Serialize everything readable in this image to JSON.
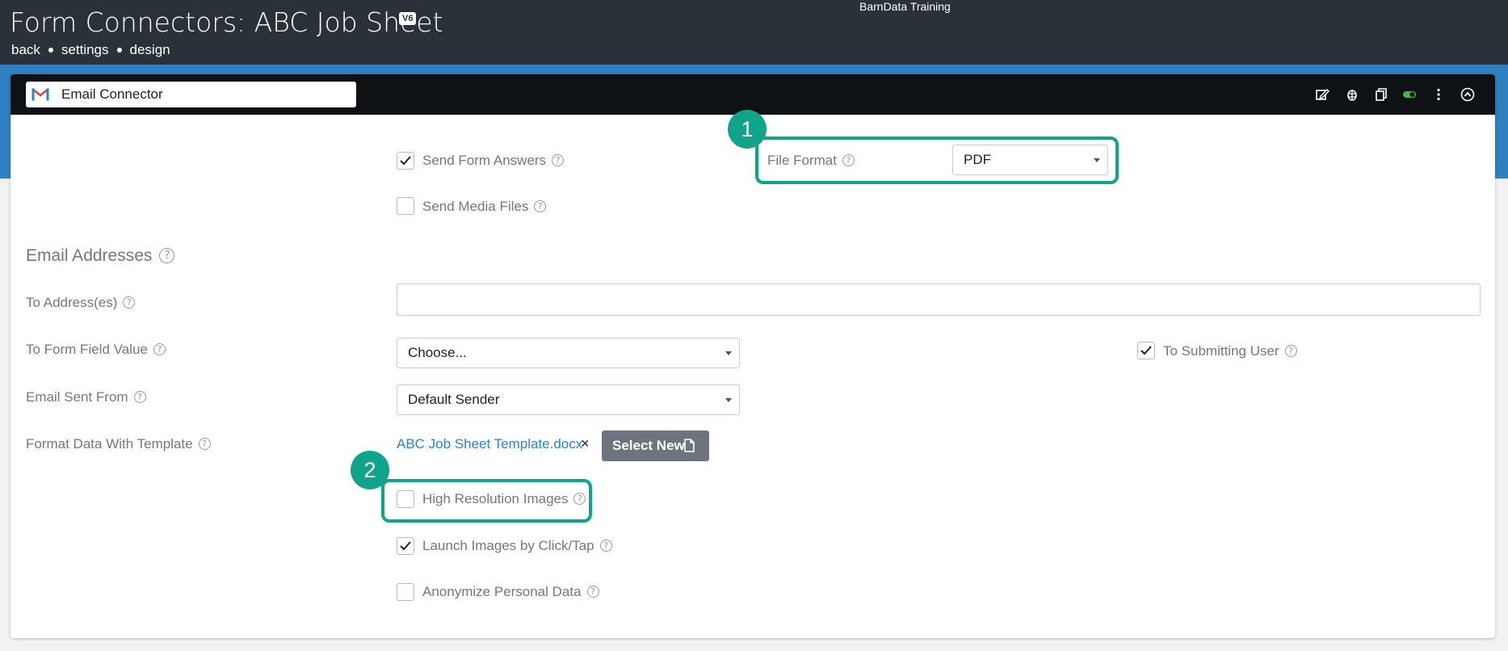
{
  "header": {
    "title": "Form Connectors: ABC Job Sheet",
    "version_badge": "V6",
    "org_name": "BarnData Training",
    "breadcrumbs": [
      "back",
      "settings",
      "design"
    ]
  },
  "connector": {
    "name": "Email Connector",
    "icon": "gmail-icon",
    "header_icons": [
      "edit-icon",
      "bug-icon",
      "copy-icon",
      "toggle-on-icon",
      "more-vertical-icon",
      "collapse-up-icon"
    ],
    "toggle_color": "#4caf50"
  },
  "options": {
    "send_form_answers": {
      "label": "Send Form Answers",
      "checked": true
    },
    "send_media_files": {
      "label": "Send Media Files",
      "checked": false
    },
    "file_format": {
      "label": "File Format",
      "value": "PDF"
    }
  },
  "email_section": {
    "title": "Email Addresses",
    "to_addresses": {
      "label": "To Address(es)",
      "value": ""
    },
    "to_form_field_value": {
      "label": "To Form Field Value",
      "value": "Choose..."
    },
    "to_submitting_user": {
      "label": "To Submitting User",
      "checked": true
    },
    "email_sent_from": {
      "label": "Email Sent From",
      "value": "Default Sender"
    },
    "format_template": {
      "label": "Format Data With Template",
      "file": "ABC Job Sheet Template.docx",
      "remove": "×",
      "select_new": "Select New"
    },
    "high_res_images": {
      "label": "High Resolution Images",
      "checked": false
    },
    "launch_images": {
      "label": "Launch Images by Click/Tap",
      "checked": true
    },
    "anonymize": {
      "label": "Anonymize Personal Data",
      "checked": false
    }
  },
  "callouts": [
    "1",
    "2"
  ],
  "colors": {
    "accent": "#10a58a",
    "header_bg": "#2a3139",
    "band_blue": "#2f7fc1",
    "link": "#2a86d1"
  }
}
